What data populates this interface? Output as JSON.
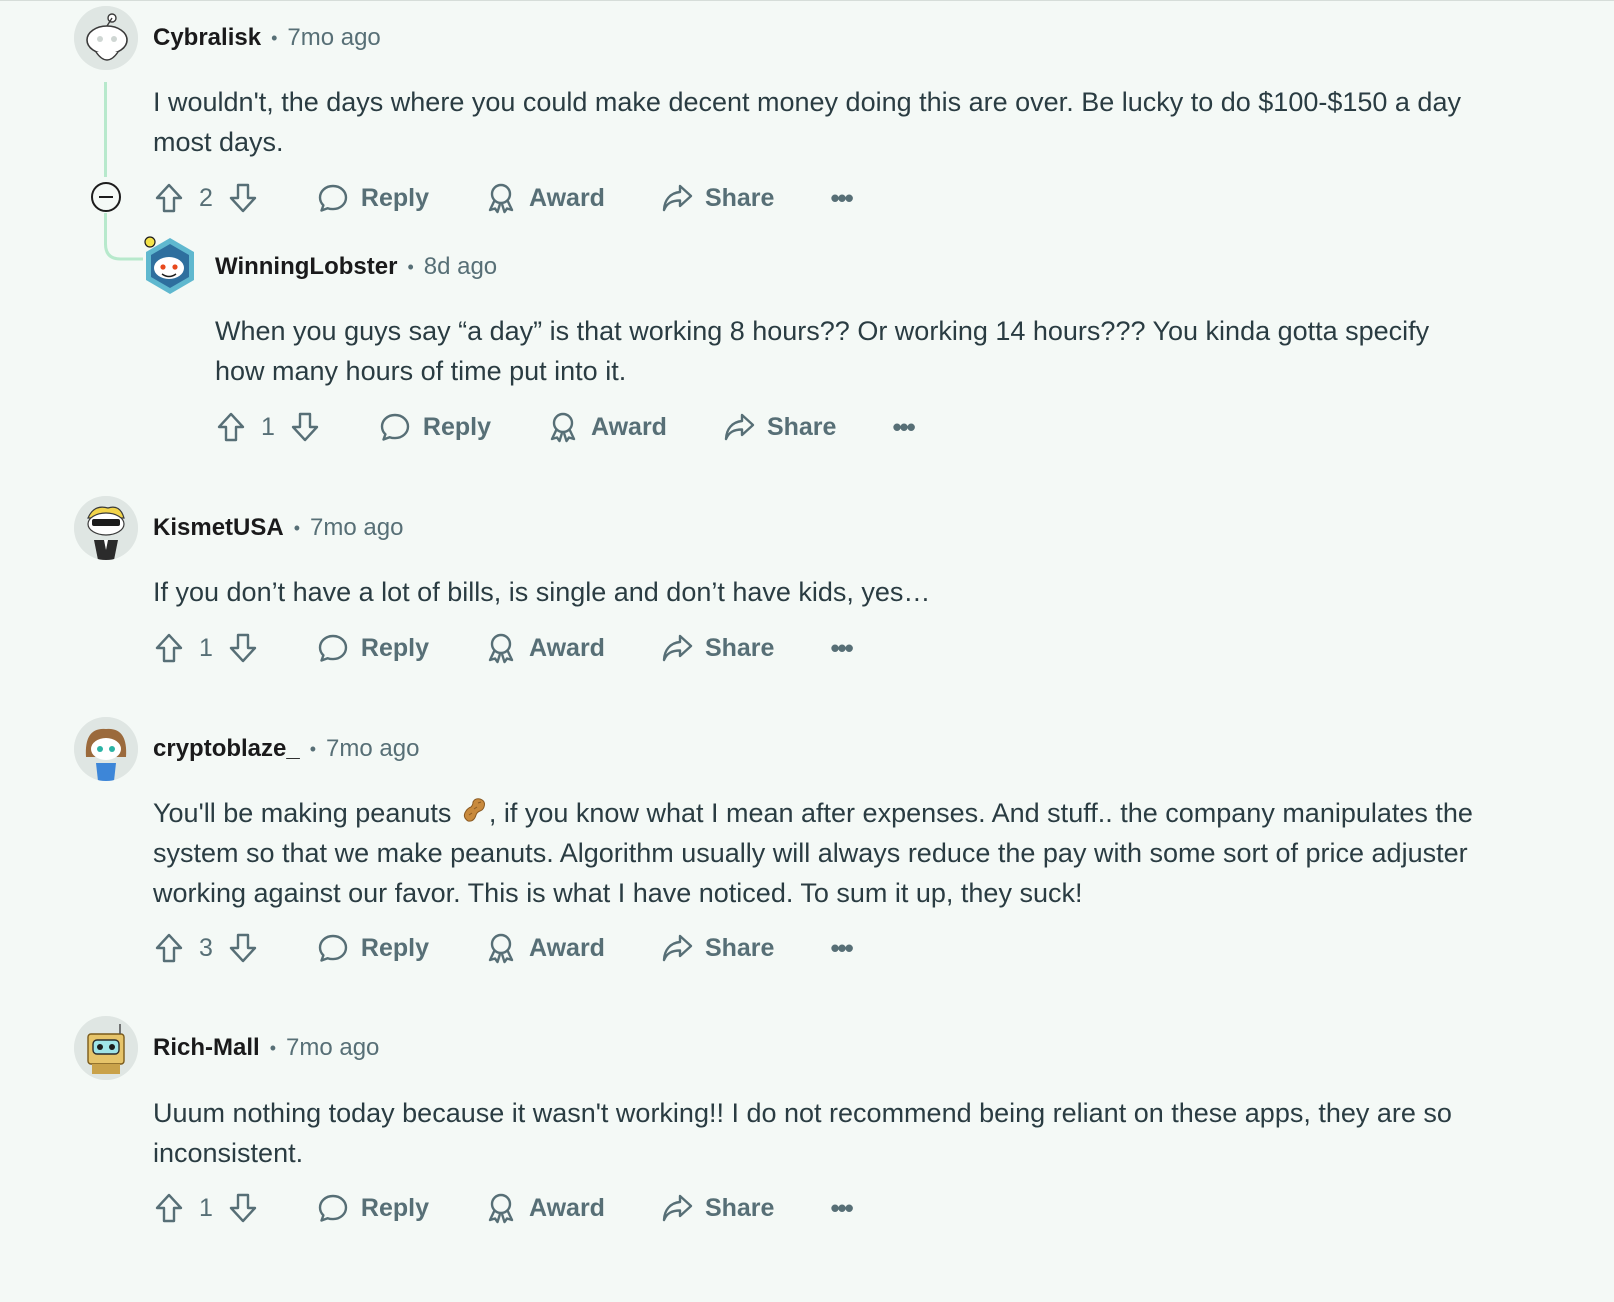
{
  "actions": {
    "reply_label": "Reply",
    "award_label": "Award",
    "share_label": "Share",
    "more_label": "•••"
  },
  "comments": [
    {
      "author": "Cybralisk",
      "separator": "•",
      "time": "7mo ago",
      "text": "I wouldn't, the days where you could make decent money doing this are over. Be lucky to do $100-$150 a day most days.",
      "score": "2"
    },
    {
      "author": "WinningLobster",
      "separator": "•",
      "time": "8d ago",
      "text": "When you guys say “a day” is that working 8 hours?? Or working 14 hours??? You kinda gotta specify how many hours of time put into it.",
      "score": "1"
    },
    {
      "author": "KismetUSA",
      "separator": "•",
      "time": "7mo ago",
      "text": "If you don’t have a lot of bills, is single and don’t have kids, yes…",
      "score": "1"
    },
    {
      "author": "cryptoblaze_",
      "separator": "•",
      "time": "7mo ago",
      "text_before_emoji": "You'll be making peanuts ",
      "text_after_emoji": ", if you know what I mean after expenses. And stuff.. the company manipulates the system so that we make peanuts. Algorithm usually will always reduce the pay with some sort of price adjuster working against our favor. This is what I have noticed. To sum it up, they suck!",
      "score": "3"
    },
    {
      "author": "Rich-Mall",
      "separator": "•",
      "time": "7mo ago",
      "text": "Uuum nothing today because it wasn't working!! I do not recommend being reliant on these apps, they are so inconsistent.",
      "score": "1"
    }
  ],
  "icons": {
    "upvote": "upvote-icon",
    "downvote": "downvote-icon",
    "reply": "reply-icon",
    "award": "award-icon",
    "share": "share-icon",
    "collapse": "collapse-icon",
    "peanut": "peanut-emoji"
  },
  "colors": {
    "background": "#f4f9f6",
    "thread_line": "#b7e9cc",
    "meta_text": "#576f76",
    "body_text": "#2a3c42"
  }
}
